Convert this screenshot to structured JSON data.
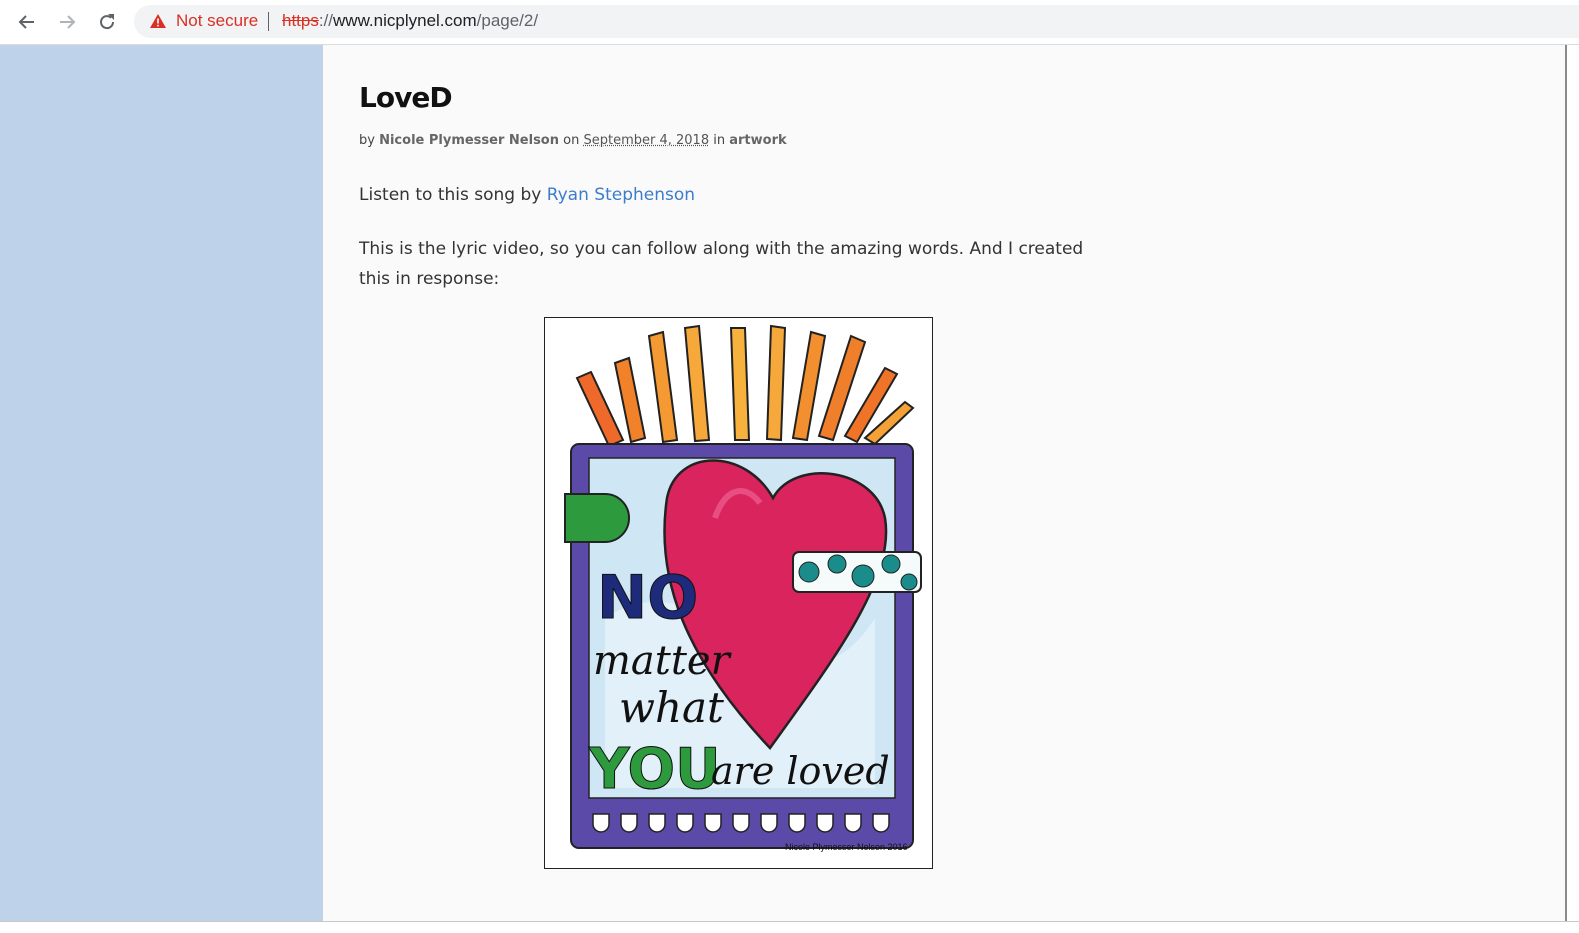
{
  "browser": {
    "security_label": "Not secure",
    "url_scheme": "https",
    "url_sep": "://",
    "url_host": "www.nicplynel.com",
    "url_path": "/page/2/"
  },
  "post": {
    "title": "LoveD",
    "meta": {
      "by": "by",
      "author": "Nicole Plymesser Nelson",
      "on": "on",
      "date": "September 4, 2018",
      "in": "in",
      "category": "artwork"
    },
    "paragraph1_prefix": "Listen to this song by ",
    "paragraph1_link": "Ryan Stephenson",
    "paragraph2": "This is the lyric video, so you can follow along with the amazing words.  And I created this in response:",
    "artwork": {
      "line1": "NO",
      "line2": "matter",
      "line3": "what",
      "line4a": "YOU",
      "line4b": "are loved",
      "credit": "Nicole Plymesser Nelson 2016"
    }
  },
  "colors": {
    "sidebar": "#bed2ea",
    "content_bg": "#fafafa",
    "link": "#3c7ccb",
    "warning": "#d93025"
  },
  "icons": [
    "back-arrow-icon",
    "forward-arrow-icon",
    "reload-icon",
    "warning-icon"
  ]
}
